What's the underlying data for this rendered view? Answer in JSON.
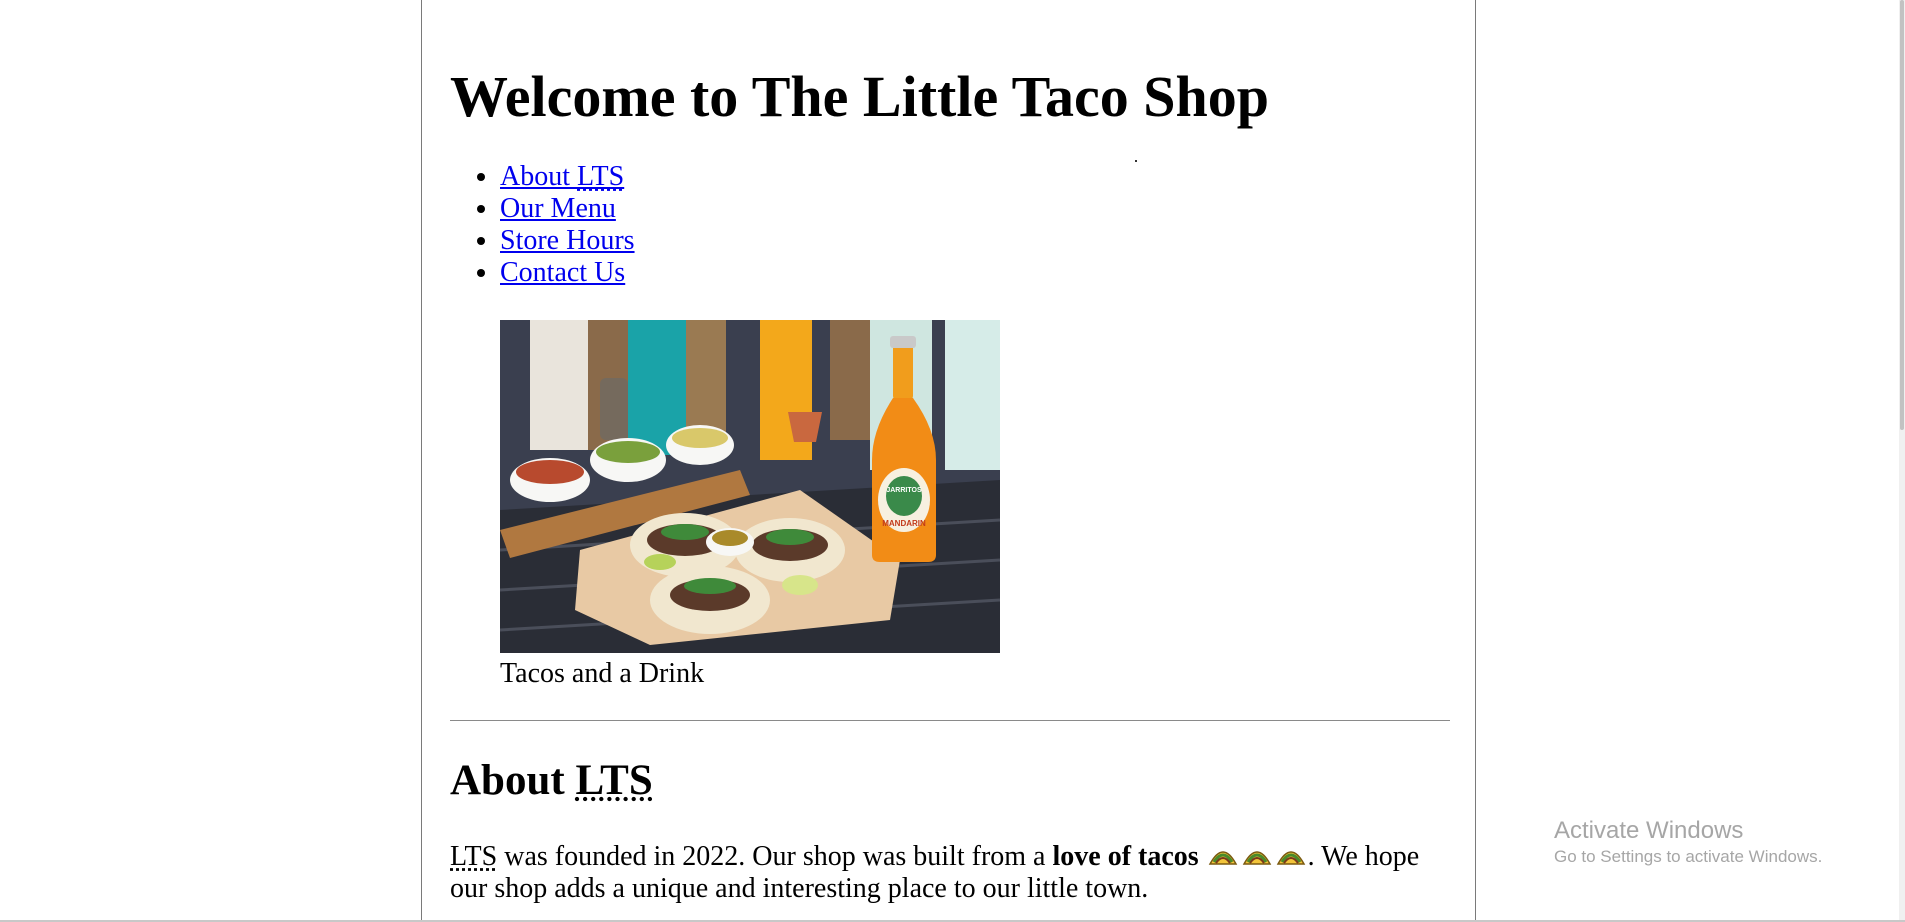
{
  "page": {
    "title": "Welcome to The Little Taco Shop"
  },
  "nav": {
    "items": [
      {
        "label_prefix": "About ",
        "abbr": "LTS",
        "label": "About LTS"
      },
      {
        "label": "Our Menu"
      },
      {
        "label": "Store Hours"
      },
      {
        "label": "Contact Us"
      }
    ]
  },
  "figure": {
    "caption": "Tacos and a Drink",
    "bottle_label": "JARRITOS",
    "bottle_flavor": "MANDARIN"
  },
  "about": {
    "heading_prefix": "About ",
    "heading_abbr": "LTS",
    "text_abbr": "LTS",
    "text_part1": " was founded in 2022. Our shop was built from a ",
    "text_bold": "love of tacos",
    "text_part2": ". We hope our shop adds a unique and interesting place to our little town.",
    "taco_icons": [
      "taco-icon",
      "taco-icon",
      "taco-icon"
    ]
  },
  "watermark": {
    "title": "Activate Windows",
    "subtitle": "Go to Settings to activate Windows."
  },
  "colors": {
    "link": "#0000ee",
    "border": "#7a7a7a",
    "watermark": "#a6a6a6"
  }
}
